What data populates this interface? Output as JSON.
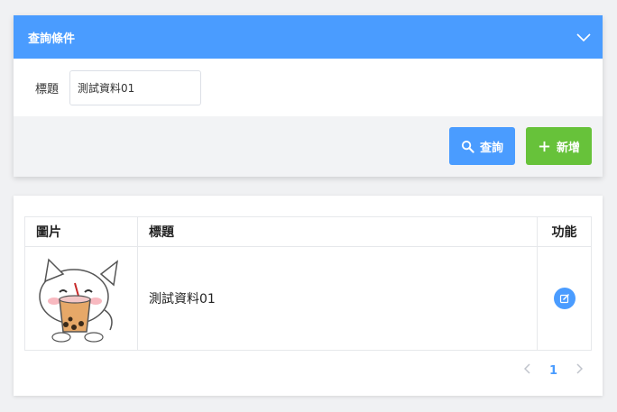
{
  "query_panel": {
    "title": "查詢條件",
    "toggle_icon": "chevron-down-icon",
    "form": {
      "title_label": "標題",
      "title_value": "測試資料01"
    },
    "search_button": {
      "label": "查詢",
      "icon": "search-icon"
    },
    "add_button": {
      "label": "新增",
      "icon": "plus-icon"
    }
  },
  "table": {
    "columns": [
      "圖片",
      "標題",
      "功能"
    ],
    "rows": [
      {
        "image": "bubble-tea-cat-sticker",
        "title": "測試資料01",
        "action_icon": "edit-icon"
      }
    ]
  },
  "pagination": {
    "prev_icon": "chevron-left-icon",
    "current_page": "1",
    "next_icon": "chevron-right-icon"
  },
  "colors": {
    "primary": "#4a9cff",
    "success": "#67c23a",
    "background": "#f0f1f3"
  }
}
